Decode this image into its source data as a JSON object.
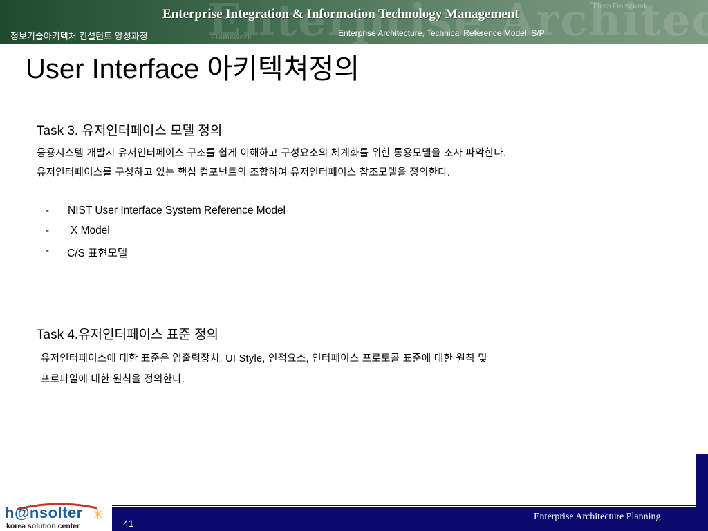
{
  "header": {
    "banner_title": "Enterprise Integration & Information Technology Management",
    "course": "정보기술아키텍처 컨설턴트 양성과정",
    "subtitle": "Enterprise Architecture, Technical Reference Model, S/P",
    "watermark": "Enterprise Architecture Mod",
    "sub_watermark": "Framework",
    "ptech_watermark": "Ptech Framework"
  },
  "page_title": "User Interface 아키텍쳐정의",
  "task3": {
    "heading": "Task 3. 유저인터페이스 모델 정의",
    "lines": [
      "응용시스템 개발시 유저인터페이스 구조를 쉽게 이해하고 구성요소의 체계화를 위한 통용모델을 조사 파악한다.",
      "유저인터페이스를 구성하고 있는 핵심 컴포넌트의 조합하여 유저인터페이스 참조모델을 정의한다."
    ],
    "bullets": [
      {
        "dash": "-",
        "text": "NIST User Interface System Reference Model"
      },
      {
        "dash": "-",
        "text": "X Model"
      },
      {
        "dash": "-",
        "text": "C/S  표현모델"
      }
    ]
  },
  "task4": {
    "heading": "Task 4.유저인터페이스  표준 정의",
    "lines": [
      "유저인터페이스에 대한 표준은 입출력장치, UI Style,  인적요소, 인터페이스 프로토콜 표준에 대한 원칙 및",
      "프로파일에 대한  원칙을 정의한다."
    ]
  },
  "footer": {
    "page_number": "41",
    "caption": "Enterprise Architecture Planning",
    "logo_main": "h@nsolter",
    "logo_sub": "korea solution center"
  },
  "colors": {
    "banner": "#2f5c3d",
    "footer_bar": "#0a0a6e",
    "logo_blue": "#1a5fa0",
    "logo_swoosh": "#c0392b",
    "logo_star": "#f2b133"
  },
  "icons": {
    "logo_star": "star-burst-icon",
    "logo_swoosh": "swoosh-arc-icon"
  }
}
